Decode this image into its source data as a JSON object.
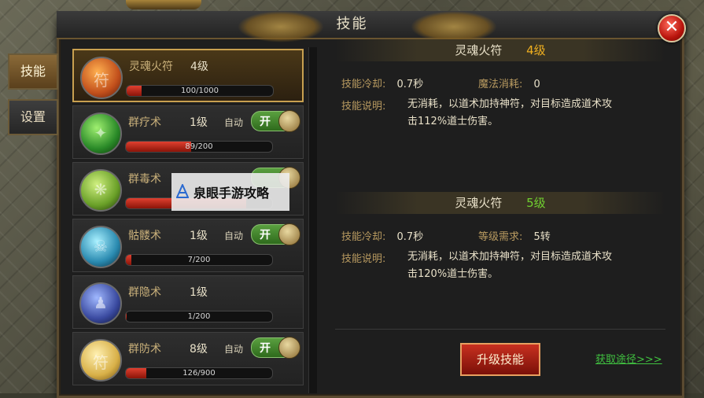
{
  "window": {
    "title": "技能",
    "close_icon": "close-icon"
  },
  "side_tabs": [
    {
      "label": "技能",
      "active": true
    },
    {
      "label": "设置",
      "active": false
    }
  ],
  "skills": [
    {
      "name": "灵魂火符",
      "level": "4级",
      "auto": "",
      "toggle": "",
      "progress": "100/1000",
      "fill": 0.1,
      "icon": "talisman-icon",
      "orb_color": "#c2501c"
    },
    {
      "name": "群疗术",
      "level": "1级",
      "auto": "自动",
      "toggle": "开",
      "progress": "89/200",
      "fill": 0.445,
      "icon": "heal-icon",
      "orb_color": "#2a8a28"
    },
    {
      "name": "群毒术",
      "level": "",
      "auto": "",
      "toggle": "",
      "progress": "",
      "fill": 0.82,
      "icon": "poison-icon",
      "orb_color": "#6aa028"
    },
    {
      "name": "骷髅术",
      "level": "1级",
      "auto": "自动",
      "toggle": "开",
      "progress": "7/200",
      "fill": 0.035,
      "icon": "skull-icon",
      "orb_color": "#2a8ab0"
    },
    {
      "name": "群隐术",
      "level": "1级",
      "auto": "",
      "toggle": "",
      "progress": "1/200",
      "fill": 0.005,
      "icon": "stealth-icon",
      "orb_color": "#3a4aa0"
    },
    {
      "name": "群防术",
      "level": "8级",
      "auto": "自动",
      "toggle": "开",
      "progress": "126/900",
      "fill": 0.14,
      "icon": "shield-talisman-icon",
      "orb_color": "#d8b048"
    }
  ],
  "current": {
    "name": "灵魂火符",
    "level": "4级",
    "cooldown_label": "技能冷却:",
    "cooldown": "0.7秒",
    "mana_label": "魔法消耗:",
    "mana": "0",
    "desc_label": "技能说明:",
    "desc": "无消耗，以道术加持神符，对目标造成道术攻击112%道士伤害。"
  },
  "next": {
    "name": "灵魂火符",
    "level": "5级",
    "cooldown_label": "技能冷却:",
    "cooldown": "0.7秒",
    "req_label": "等级需求:",
    "req": "5转",
    "desc_label": "技能说明:",
    "desc": "无消耗，以道术加持神符，对目标造成道术攻击120%道士伤害。"
  },
  "upgrade_label": "升级技能",
  "obtain_label": "获取途径>>>",
  "watermark": "泉眼手游攻略"
}
